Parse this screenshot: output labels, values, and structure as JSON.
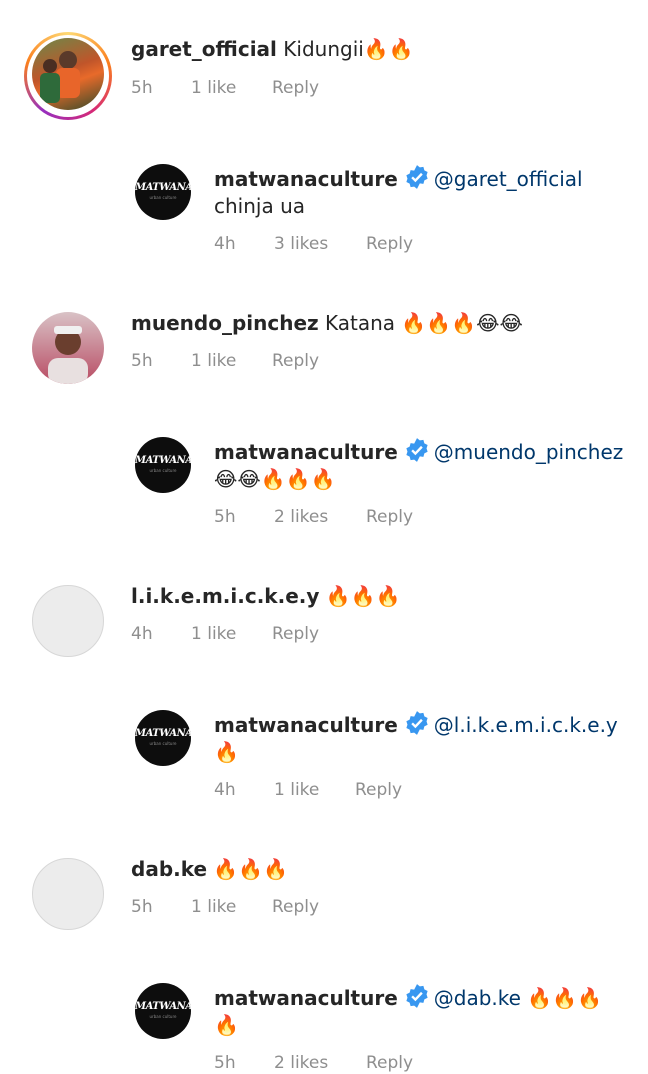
{
  "comments": [
    {
      "user": "garet_official",
      "text": "Kidungii🔥🔥",
      "time": "5h",
      "likes": "1 like",
      "reply": "Reply"
    },
    {
      "user": "matwanaculture",
      "mention": "@garet_official",
      "text": "chinja ua",
      "time": "4h",
      "likes": "3 likes",
      "reply": "Reply"
    },
    {
      "user": "muendo_pinchez",
      "text": "Katana 🔥🔥🔥😂😂",
      "time": "5h",
      "likes": "1 like",
      "reply": "Reply"
    },
    {
      "user": "matwanaculture",
      "mention": "@muendo_pinchez",
      "text": "😂😂🔥🔥🔥",
      "time": "5h",
      "likes": "2 likes",
      "reply": "Reply"
    },
    {
      "user": "l.i.k.e.m.i.c.k.e.y",
      "text": "🔥🔥🔥",
      "time": "4h",
      "likes": "1 like",
      "reply": "Reply"
    },
    {
      "user": "matwanaculture",
      "mention": "@l.i.k.e.m.i.c.k.e.y",
      "text": "🔥",
      "time": "4h",
      "likes": "1 like",
      "reply": "Reply"
    },
    {
      "user": "dab.ke",
      "text": "🔥🔥🔥",
      "time": "5h",
      "likes": "1 like",
      "reply": "Reply"
    },
    {
      "user": "matwanaculture",
      "mention": "@dab.ke",
      "mention_suffix": "🔥🔥🔥",
      "text": "🔥",
      "time": "5h",
      "likes": "2 likes",
      "reply": "Reply"
    }
  ],
  "logo": {
    "text": "MATWANA",
    "sub": "urban culture"
  },
  "colors": {
    "verified": "#3897f0",
    "mention": "#00376b",
    "meta": "#8e8e8e"
  }
}
